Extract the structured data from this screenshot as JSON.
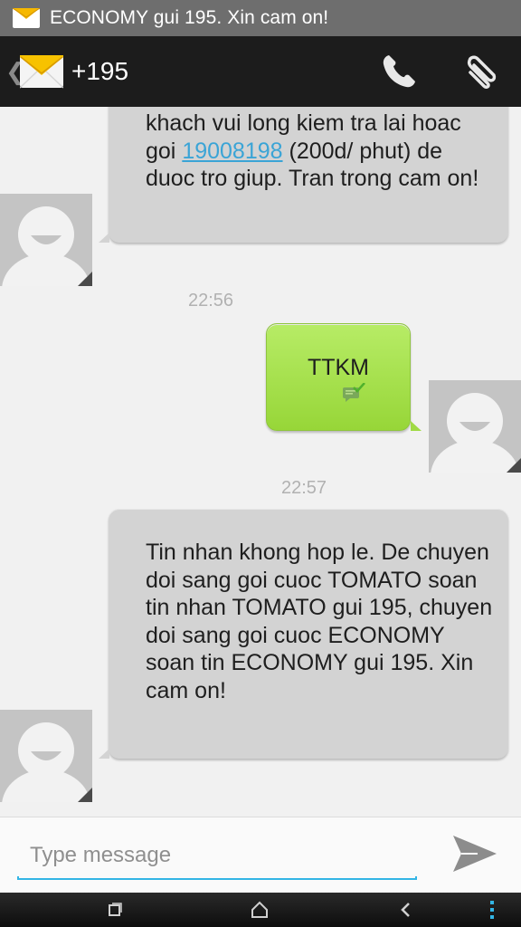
{
  "status_bar": {
    "notification_text": "ECONOMY gui 195. Xin cam on!"
  },
  "action_bar": {
    "back_glyph": "❮",
    "contact": "+195",
    "icons": [
      "envelope-icon",
      "phone-icon",
      "paperclip-icon"
    ]
  },
  "messages": [
    {
      "direction": "incoming",
      "text_before_link": "khach vui long kiem tra lai hoac goi ",
      "link": "19008198",
      "text_after_link": " (200d/ phut) de duoc tro giup. Tran trong cam on!"
    },
    {
      "direction": "outgoing",
      "timestamp": "22:56",
      "text": "TTKM"
    },
    {
      "direction": "incoming",
      "timestamp": "22:57",
      "text": "Tin nhan khong hop le. De chuyen doi sang goi cuoc TOMATO soan tin nhan TOMATO gui 195, chuyen doi sang goi cuoc ECONOMY soan tin ECONOMY gui 195. Xin cam on!"
    }
  ],
  "compose": {
    "placeholder": "Type message"
  },
  "colors": {
    "accent": "#33b5e5",
    "outgoing_bubble": "#a5e04a",
    "incoming_bubble": "#d3d3d3",
    "link": "#3aa4d6"
  }
}
